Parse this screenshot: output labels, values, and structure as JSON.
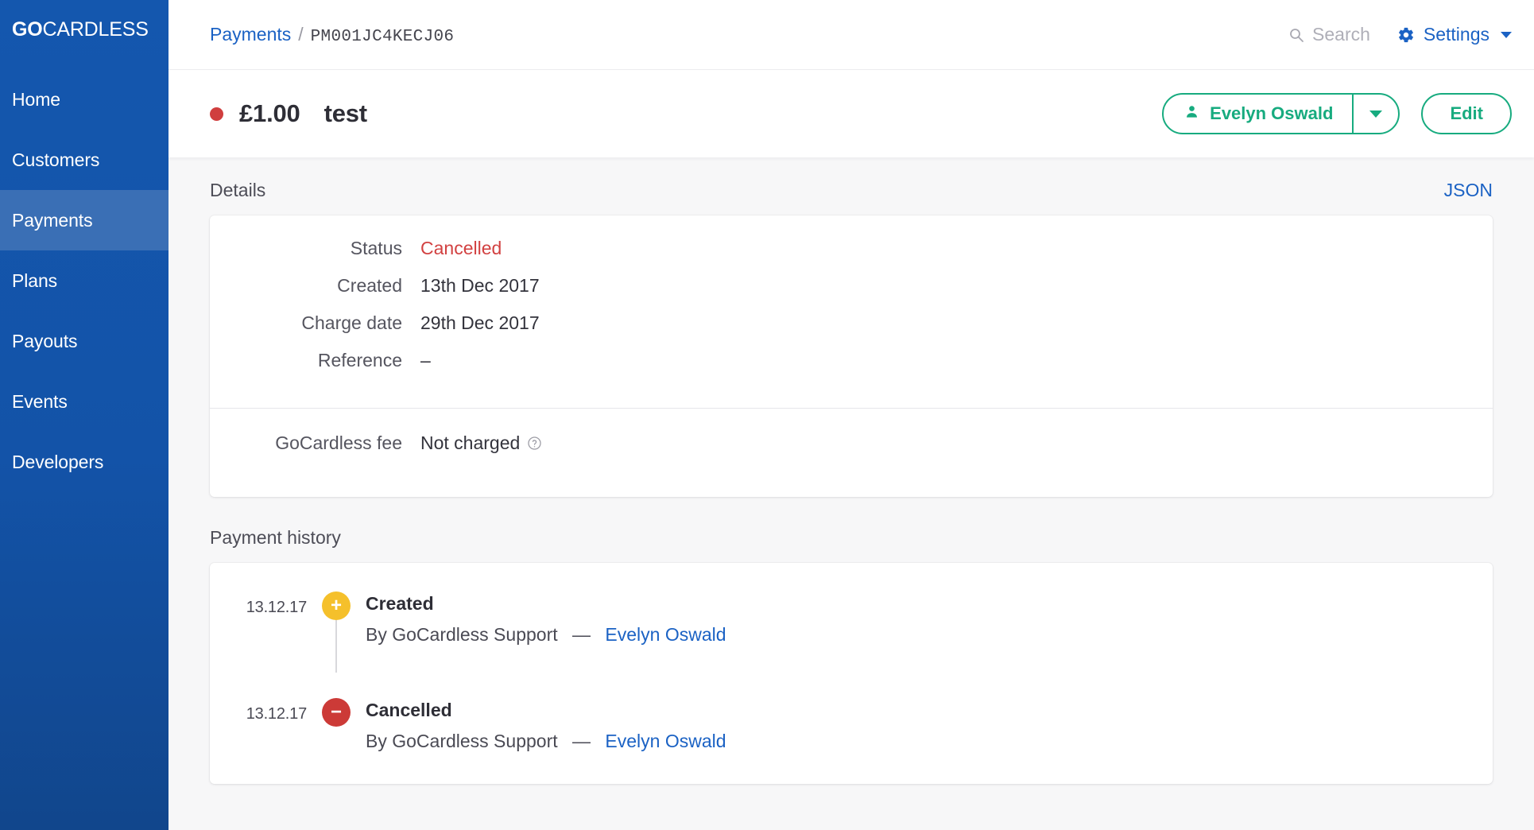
{
  "sidebar": {
    "brand_bold": "GO",
    "brand_rest": "CARDLESS",
    "items": [
      {
        "label": "Home",
        "active": false
      },
      {
        "label": "Customers",
        "active": false
      },
      {
        "label": "Payments",
        "active": true
      },
      {
        "label": "Plans",
        "active": false
      },
      {
        "label": "Payouts",
        "active": false
      },
      {
        "label": "Events",
        "active": false
      },
      {
        "label": "Developers",
        "active": false
      }
    ]
  },
  "topbar": {
    "breadcrumb_parent": "Payments",
    "breadcrumb_separator": "/",
    "breadcrumb_current": "PM001JC4KECJ06",
    "search_placeholder": "Search",
    "search_icon": "search-icon",
    "settings_label": "Settings",
    "settings_icon": "gear-icon",
    "settings_caret": "chevron-down-icon"
  },
  "payment_header": {
    "status_color": "#D03E3E",
    "amount": "£1.00",
    "description": "test",
    "customer_button": "Evelyn Oswald",
    "customer_icon": "person-icon",
    "dropdown_icon": "chevron-down-icon",
    "edit_button": "Edit",
    "accent_color": "#17AB7F"
  },
  "details": {
    "title": "Details",
    "json_link": "JSON",
    "rows": [
      {
        "label": "Status",
        "value": "Cancelled",
        "status": true
      },
      {
        "label": "Created",
        "value": "13th Dec 2017",
        "status": false
      },
      {
        "label": "Charge date",
        "value": "29th Dec 2017",
        "status": false
      },
      {
        "label": "Reference",
        "value": "–",
        "status": false
      }
    ],
    "fee": {
      "label": "GoCardless fee",
      "value": "Not charged",
      "help_icon": "help-circle-icon"
    }
  },
  "history": {
    "title": "Payment history",
    "entries": [
      {
        "date": "13.12.17",
        "badge": "+",
        "badge_kind": "created",
        "badge_color": "#F5C02B",
        "title": "Created",
        "by_text": "By GoCardless Support",
        "dash": "—",
        "actor": "Evelyn Oswald"
      },
      {
        "date": "13.12.17",
        "badge": "−",
        "badge_kind": "cancelled",
        "badge_color": "#CC3A37",
        "title": "Cancelled",
        "by_text": "By GoCardless Support",
        "dash": "—",
        "actor": "Evelyn Oswald"
      }
    ]
  }
}
